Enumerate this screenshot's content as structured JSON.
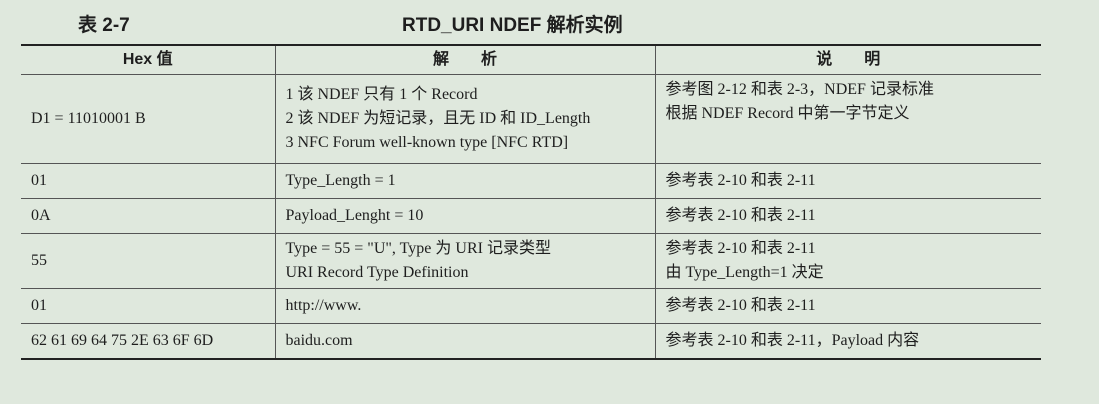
{
  "caption": {
    "number": "表 2-7",
    "title": "RTD_URI NDEF 解析实例"
  },
  "table": {
    "headers": [
      "Hex 值",
      "解　　析",
      "说　　明"
    ],
    "rows": [
      {
        "hex": "D1 = 11010001 B",
        "analysis": [
          "1 该 NDEF 只有 1 个 Record",
          "2 该 NDEF 为短记录，且无 ID 和 ID_Length",
          "3 NFC Forum well-known type [NFC RTD]"
        ],
        "note": [
          "参考图 2-12 和表 2-3，NDEF 记录标准",
          "根据 NDEF Record 中第一字节定义"
        ]
      },
      {
        "hex": "01",
        "analysis": [
          "Type_Length = 1"
        ],
        "note": [
          "参考表 2-10 和表 2-11"
        ]
      },
      {
        "hex": "0A",
        "analysis": [
          "Payload_Lenght = 10"
        ],
        "note": [
          "参考表 2-10 和表 2-11"
        ]
      },
      {
        "hex": "55",
        "analysis": [
          "Type = 55 = \"U\", Type 为 URI 记录类型",
          "URI Record Type Definition"
        ],
        "note": [
          "参考表 2-10 和表 2-11",
          "由 Type_Length=1 决定"
        ]
      },
      {
        "hex": "01",
        "analysis": [
          "http://www."
        ],
        "note": [
          "参考表 2-10 和表 2-11"
        ]
      },
      {
        "hex": "62 61 69 64 75 2E 63 6F 6D",
        "analysis": [
          "baidu.com"
        ],
        "note": [
          "参考表 2-10 和表 2-11，Payload 内容"
        ]
      }
    ]
  }
}
